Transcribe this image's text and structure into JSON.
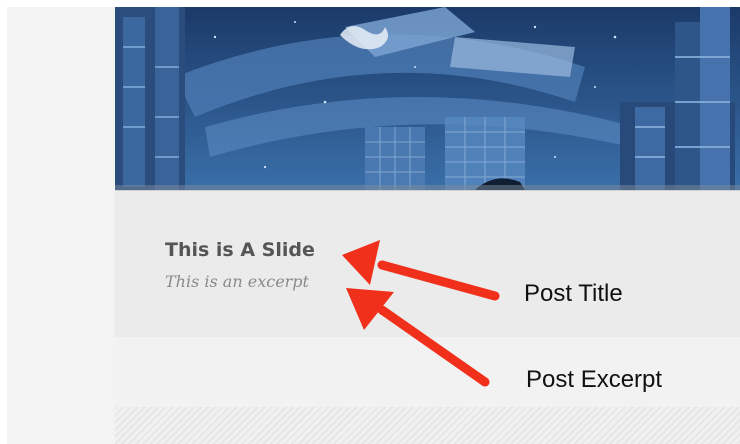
{
  "slide": {
    "title": "This is A Slide",
    "excerpt": "This is an excerpt"
  },
  "annotations": {
    "post_title_label": "Post Title",
    "post_excerpt_label": "Post Excerpt",
    "arrow_color": "#f0301a"
  },
  "colors": {
    "caption_background": "#ebebeb",
    "title_text": "#555555",
    "excerpt_text": "#8a8a8a"
  },
  "icons": [
    "arrow-icon"
  ]
}
